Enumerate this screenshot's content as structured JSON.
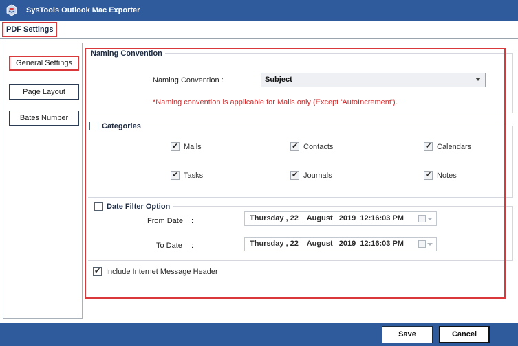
{
  "window": {
    "title": "SysTools Outlook Mac Exporter"
  },
  "tabs": [
    {
      "label": "PDF Settings"
    }
  ],
  "sidebar": {
    "items": [
      {
        "label": "General Settings"
      },
      {
        "label": "Page Layout"
      },
      {
        "label": "Bates Number"
      }
    ]
  },
  "naming": {
    "group_title": "Naming Convention",
    "field_label": "Naming Convention :",
    "selected": "Subject",
    "note": "*Naming convention is applicable for Mails only (Except 'AutoIncrement')."
  },
  "categories": {
    "label": "Categories",
    "checked": false,
    "items": [
      {
        "label": "Mails",
        "checked": true
      },
      {
        "label": "Contacts",
        "checked": true
      },
      {
        "label": "Calendars",
        "checked": true
      },
      {
        "label": "Tasks",
        "checked": true
      },
      {
        "label": "Journals",
        "checked": true
      },
      {
        "label": "Notes",
        "checked": true
      }
    ]
  },
  "date_filter": {
    "label": "Date Filter Option",
    "checked": false,
    "from_label": "From Date",
    "to_label": "To Date",
    "colon": ":",
    "from_value": "Thursday , 22    August   2019  12:16:03 PM",
    "to_value": "Thursday , 22    August   2019  12:16:03 PM"
  },
  "internet_header": {
    "label": "Include Internet Message Header",
    "checked": true
  },
  "footer": {
    "save_label": "Save",
    "cancel_label": "Cancel"
  },
  "colors": {
    "title_bar": "#2f5a9c",
    "highlight": "#d9393a",
    "note_text": "#d22a2a"
  },
  "icons": {
    "app": "systools-logo-icon",
    "check": "checkmark-icon",
    "calendar": "calendar-icon",
    "dropdown": "chevron-down-icon"
  }
}
